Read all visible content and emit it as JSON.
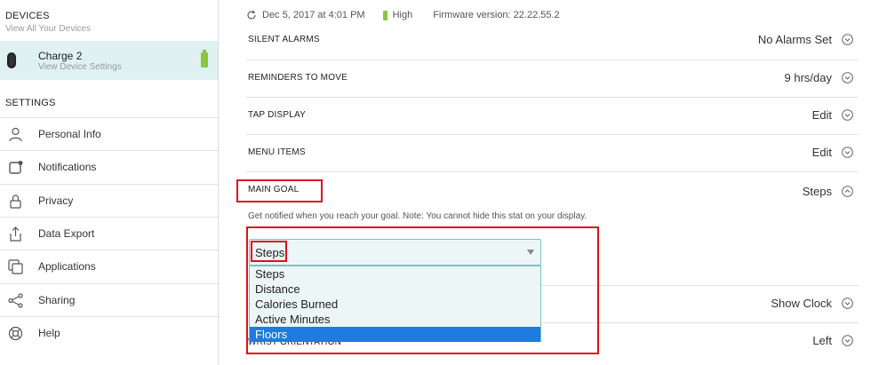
{
  "sidebar": {
    "devices_heading": "DEVICES",
    "devices_sub": "View All Your Devices",
    "device": {
      "name": "Charge 2",
      "sub": "View Device Settings"
    },
    "settings_heading": "SETTINGS",
    "items": [
      {
        "label": "Personal Info",
        "icon": "person-icon"
      },
      {
        "label": "Notifications",
        "icon": "notification-icon"
      },
      {
        "label": "Privacy",
        "icon": "lock-icon"
      },
      {
        "label": "Data Export",
        "icon": "export-icon"
      },
      {
        "label": "Applications",
        "icon": "applications-icon"
      },
      {
        "label": "Sharing",
        "icon": "share-icon"
      },
      {
        "label": "Help",
        "icon": "help-icon"
      }
    ]
  },
  "status": {
    "sync_time": "Dec 5, 2017 at 4:01 PM",
    "battery": "High",
    "firmware": "Firmware version: 22.22.55.2"
  },
  "settings": {
    "silent_alarms": {
      "title": "SILENT ALARMS",
      "value": "No Alarms Set"
    },
    "reminders": {
      "title": "REMINDERS TO MOVE",
      "value": "9 hrs/day"
    },
    "tap_display": {
      "title": "TAP DISPLAY",
      "value": "Edit"
    },
    "menu_items": {
      "title": "MENU ITEMS",
      "value": "Edit"
    },
    "main_goal": {
      "title": "MAIN GOAL",
      "value": "Steps",
      "note": "Get notified when you reach your goal. Note: You cannot hide this stat on your display.",
      "selected": "Steps",
      "options": [
        "Steps",
        "Distance",
        "Calories Burned",
        "Active Minutes",
        "Floors"
      ]
    },
    "clock_display": {
      "value": "Show Clock"
    },
    "wrist_orientation": {
      "title": "WRIST ORIENTATION",
      "value": "Left"
    }
  },
  "colors": {
    "accent": "#dff1f1",
    "highlight": "#e0111a",
    "selected_option": "#1e7be0",
    "battery": "#8cc63f"
  }
}
